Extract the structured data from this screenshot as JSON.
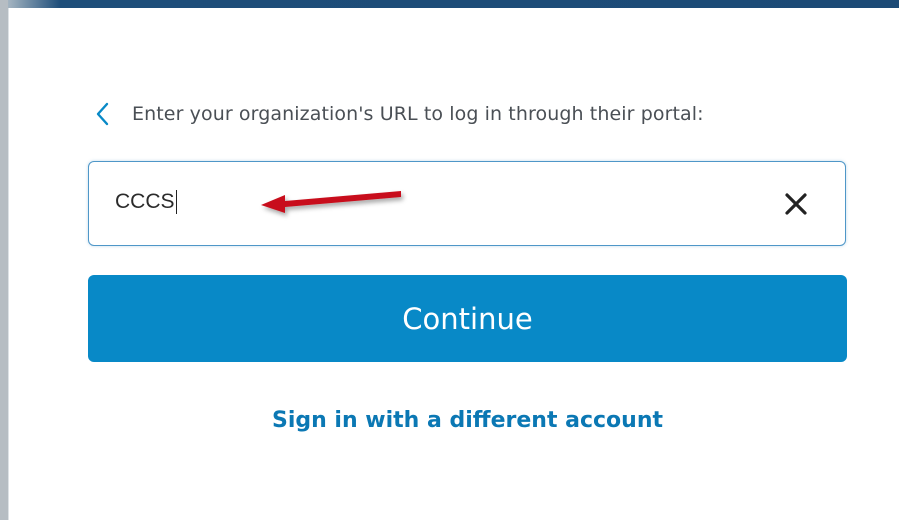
{
  "form": {
    "instruction": "Enter your organization's URL to log in through their portal:",
    "url_value": "CCCS",
    "continue_label": "Continue",
    "alt_signin_label": "Sign in with a different account"
  },
  "icons": {
    "back": "chevron-left-icon",
    "clear": "close-icon",
    "annotation": "red-arrow-icon"
  },
  "colors": {
    "accent": "#0889c7",
    "link": "#0b78b4",
    "input_border": "#4f97c8",
    "annotation": "#c8101a"
  }
}
